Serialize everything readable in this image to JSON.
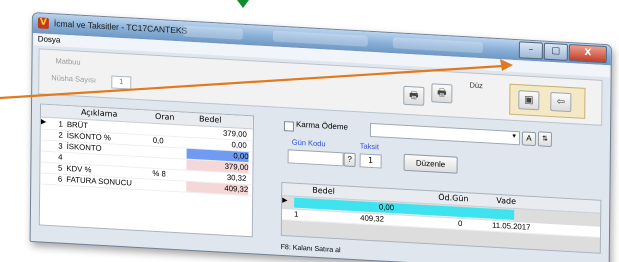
{
  "window": {
    "title": "İcmal ve Taksitler - TC17CANTEKS",
    "controls": {
      "minimize": "–",
      "maximize": "□",
      "close": "X"
    }
  },
  "menu": {
    "file": "Dosya"
  },
  "top": {
    "mabbuu_label": "Matbuu",
    "nusha_label": "Nüsha Sayısı",
    "nusha_value": "1",
    "duz_label": "Düz",
    "print_icon": "printer-icon",
    "print_settings_icon": "printer-settings-icon",
    "save_icon": "save-icon",
    "exit_icon": "exit-door-icon"
  },
  "summary_grid": {
    "headers": [
      "Açıklama",
      "Oran",
      "Bedel"
    ],
    "rows": [
      {
        "no": "1",
        "desc": "BRÜT",
        "rate": "",
        "amount": "379,00"
      },
      {
        "no": "2",
        "desc": "İSKONTO %",
        "rate": "0,0",
        "amount": "0,00"
      },
      {
        "no": "3",
        "desc": "İSKONTO",
        "rate": "",
        "amount": "0,00"
      },
      {
        "no": "4",
        "desc": "",
        "rate": "",
        "amount": "379,00"
      },
      {
        "no": "5",
        "desc": "KDV %",
        "rate": "% 8",
        "amount": "30,32"
      },
      {
        "no": "6",
        "desc": "FATURA SONUCU",
        "rate": "",
        "amount": "409,32"
      }
    ]
  },
  "installments": {
    "karma_label": "Karma Ödeme",
    "combo_value": "",
    "btn_a": "A",
    "gun_kodu_label": "Gün Kodu",
    "taksit_label": "Taksit",
    "help_btn": "?",
    "taksit_value": "1",
    "duzenle_label": "Düzenle",
    "headers": [
      "Bedel",
      "Öd.Gün",
      "Vade"
    ],
    "edit_value": "0,00",
    "rows": [
      {
        "no": "1",
        "amount": "409,32",
        "days": "0",
        "due": "11.05.2017"
      }
    ],
    "hint": "F8: Kalanı Satıra al"
  },
  "colors": {
    "arrow": "#e07a1f",
    "highlight_blue": "#6f9cf2",
    "highlight_pink": "#f6d7d7",
    "cyan_row": "#3fe3ef",
    "marker_green": "#118a2c"
  }
}
